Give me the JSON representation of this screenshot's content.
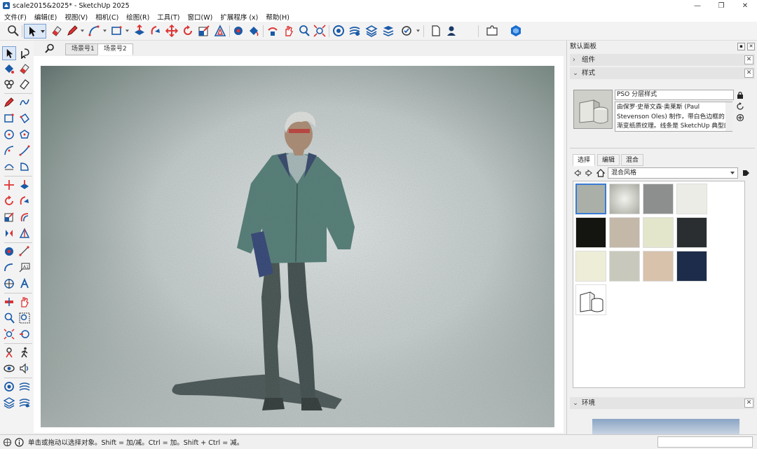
{
  "window": {
    "title": "scale2015&2025* - SketchUp 2025",
    "controls": [
      "—",
      "❐",
      "✕"
    ]
  },
  "menu": [
    "文件(F)",
    "编辑(E)",
    "视图(V)",
    "相机(C)",
    "绘图(R)",
    "工具(T)",
    "窗口(W)",
    "扩展程序 (x)",
    "帮助(H)"
  ],
  "scene_tabs": [
    "场景号1",
    "场景号2"
  ],
  "active_scene_tab": "场景号2",
  "panel": {
    "title": "默认面板",
    "sections": {
      "components": "组件",
      "styles": "样式",
      "environment": "环境"
    },
    "style_name": "PSO 分层样式",
    "style_description": "由保罗·史蒂文森·奥莱斯 (Paul Stevenson Oles) 制作，带白色边框的渐变纸质纹理。线条是 SketchUp 典型的蒂",
    "subtabs": [
      "选择",
      "编辑",
      "混合"
    ],
    "active_subtab": "选择",
    "library": "混合风格"
  },
  "status": {
    "text": "单击或拖动以选择对象。Shift = 加/减。Ctrl = 加。Shift + Ctrl = 减。"
  },
  "colors": {
    "accent": "#3a7bd5",
    "tool_red": "#d0282a",
    "tool_blue": "#1a5aa8"
  }
}
